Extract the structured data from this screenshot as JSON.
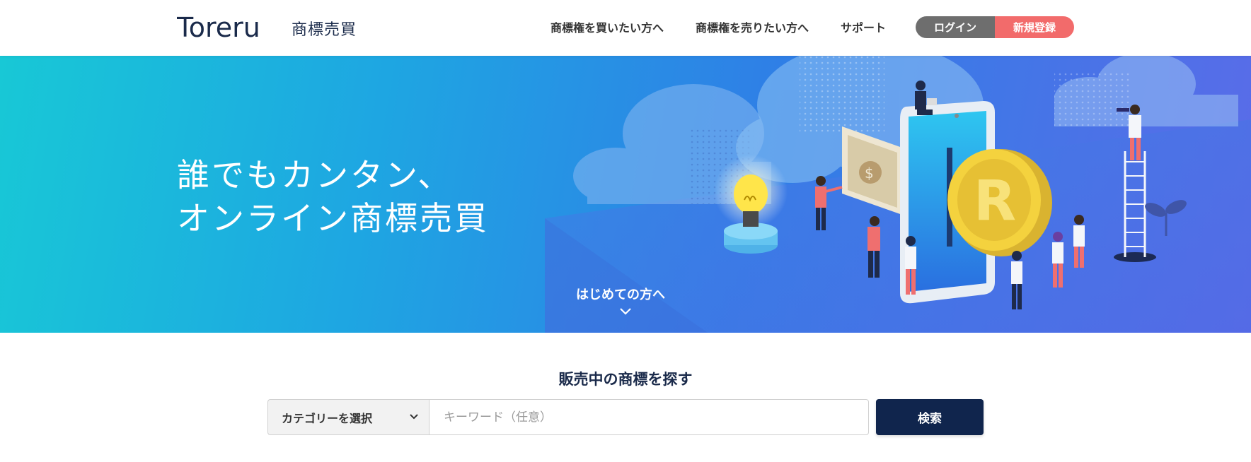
{
  "header": {
    "logo_text": "Toreru",
    "logo_sub": "商標売買",
    "nav": {
      "buy": "商標権を買いたい方へ",
      "sell": "商標権を売りたい方へ",
      "support": "サポート"
    },
    "login_label": "ログイン",
    "register_label": "新規登録"
  },
  "hero": {
    "title_line1": "誰でもカンタン、",
    "title_line2": "オンライン商標売買",
    "cta_label": "はじめての方へ",
    "coin_letter": "R",
    "bill_symbol": "$"
  },
  "search": {
    "title": "販売中の商標を探す",
    "category_selected": "カテゴリーを選択",
    "keyword_placeholder": "キーワード（任意）",
    "keyword_value": "",
    "button_label": "検索"
  },
  "colors": {
    "brand_navy": "#10254d",
    "register_red": "#f26b6b",
    "login_gray": "#6e6e6e",
    "hero_start": "#18c8d6",
    "hero_end": "#5b6be8"
  }
}
